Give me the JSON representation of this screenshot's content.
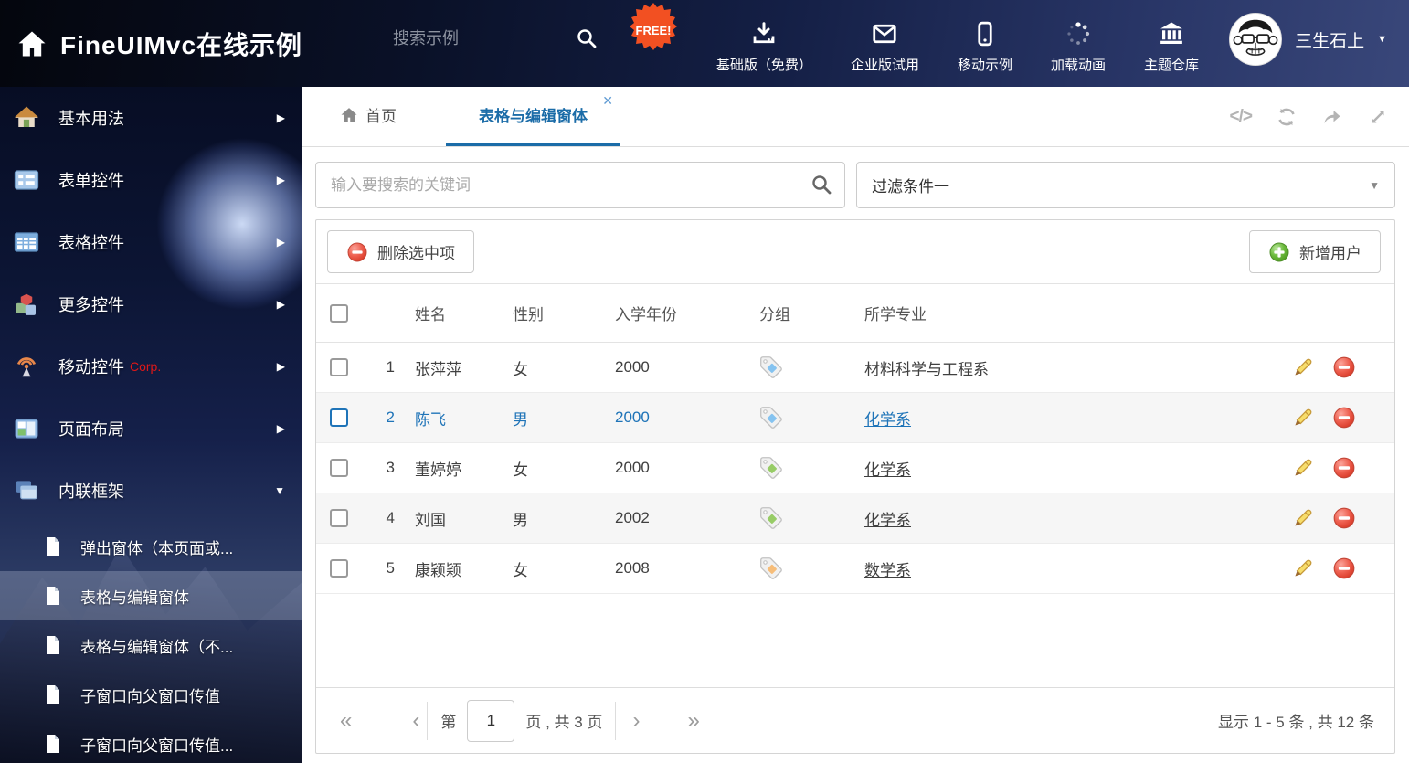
{
  "header": {
    "title": "FineUIMvc在线示例",
    "search_placeholder": "搜索示例",
    "free_badge": "FREE!",
    "nav": [
      {
        "icon": "download-icon",
        "label": "基础版（免费）"
      },
      {
        "icon": "envelope-icon",
        "label": "企业版试用"
      },
      {
        "icon": "mobile-icon",
        "label": "移动示例"
      },
      {
        "icon": "spinner-icon",
        "label": "加载动画"
      },
      {
        "icon": "bank-icon",
        "label": "主题仓库"
      }
    ],
    "user": {
      "name": "三生石上"
    }
  },
  "sidebar": {
    "items": [
      {
        "icon": "home-icon",
        "label": "基本用法"
      },
      {
        "icon": "form-icon",
        "label": "表单控件"
      },
      {
        "icon": "table-icon",
        "label": "表格控件"
      },
      {
        "icon": "cubes-icon",
        "label": "更多控件"
      },
      {
        "icon": "antenna-icon",
        "label": "移动控件",
        "badge": "Corp."
      },
      {
        "icon": "layout-icon",
        "label": "页面布局"
      },
      {
        "icon": "frames-icon",
        "label": "内联框架"
      }
    ],
    "children": [
      {
        "label": "弹出窗体（本页面或..."
      },
      {
        "label": "表格与编辑窗体",
        "selected": true
      },
      {
        "label": "表格与编辑窗体（不..."
      },
      {
        "label": "子窗口向父窗口传值"
      },
      {
        "label": "子窗口向父窗口传值..."
      }
    ]
  },
  "tabs": [
    {
      "label": "首页"
    },
    {
      "label": "表格与编辑窗体",
      "active": true
    }
  ],
  "filters": {
    "search_placeholder": "输入要搜索的关键词",
    "filter_value": "过滤条件一"
  },
  "grid": {
    "delete_button": "删除选中项",
    "add_button": "新增用户",
    "columns": {
      "name": "姓名",
      "gender": "性别",
      "year": "入学年份",
      "group": "分组",
      "major": "所学专业"
    },
    "rows": [
      {
        "num": "1",
        "name": "张萍萍",
        "gender": "女",
        "year": "2000",
        "tag_color": "#85c3f0",
        "major": "材料科学与工程系"
      },
      {
        "num": "2",
        "name": "陈飞",
        "gender": "男",
        "year": "2000",
        "tag_color": "#85c3f0",
        "major": "化学系",
        "selected": true
      },
      {
        "num": "3",
        "name": "董婷婷",
        "gender": "女",
        "year": "2000",
        "tag_color": "#97cc66",
        "major": "化学系"
      },
      {
        "num": "4",
        "name": "刘国",
        "gender": "男",
        "year": "2002",
        "tag_color": "#97cc66",
        "major": "化学系"
      },
      {
        "num": "5",
        "name": "康颖颖",
        "gender": "女",
        "year": "2008",
        "tag_color": "#f6bd79",
        "major": "数学系"
      }
    ]
  },
  "pagination": {
    "prefix": "第",
    "page": "1",
    "suffix": "页 , 共 3 页",
    "summary": "显示 1 - 5 条 , 共 12 条"
  },
  "colors": {
    "accent": "#1b6ca8",
    "selected_text": "#1f74b8",
    "badge_bg": "#f25022"
  }
}
